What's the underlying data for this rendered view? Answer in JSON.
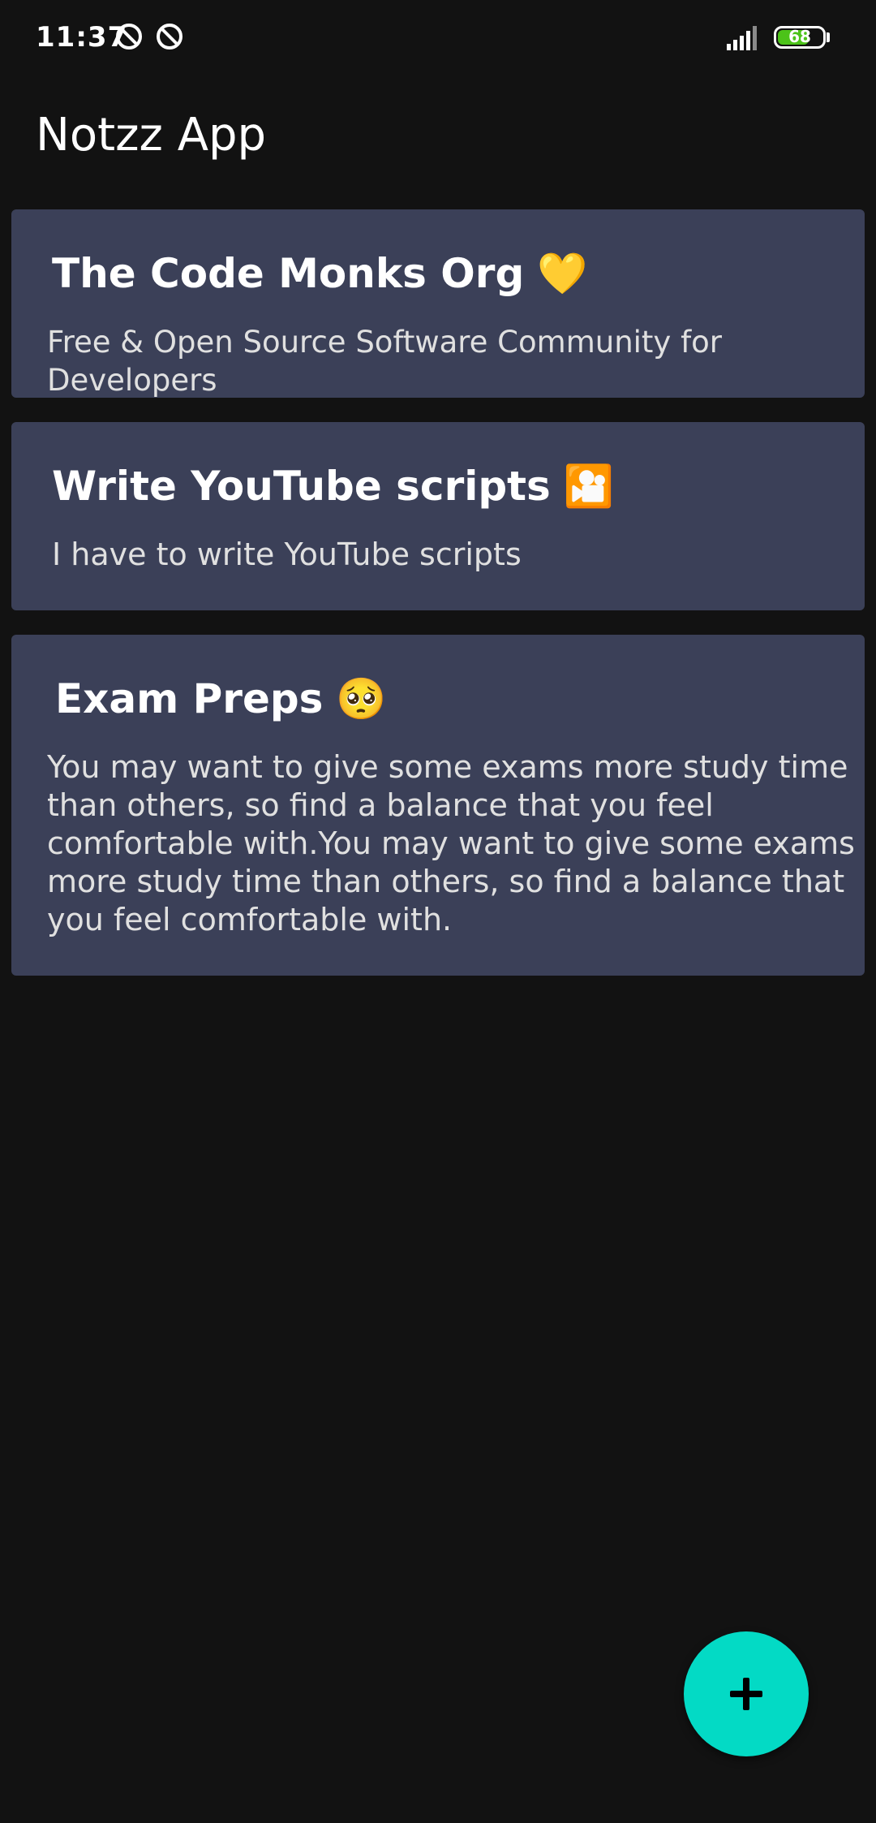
{
  "status_bar": {
    "time": "11:37",
    "battery_level": "68",
    "icons": [
      "do-not-disturb-icon",
      "do-not-disturb-icon",
      "signal-icon",
      "battery-icon"
    ]
  },
  "app": {
    "title": "Notzz App"
  },
  "notes": [
    {
      "title": "The Code Monks Org",
      "emoji": "💛",
      "body": "Free & Open Source Software Community for Developers"
    },
    {
      "title": "Write YouTube scripts",
      "emoji": "🎦",
      "body": "I have to write YouTube scripts"
    },
    {
      "title": "Exam Preps",
      "emoji": "🥺",
      "body": "You may want to give some exams more study time than others, so find a balance that you feel comfortable with.You may want to give some exams more study time than others, so find a balance that you feel comfortable with."
    }
  ],
  "fab": {
    "icon": "plus-icon"
  },
  "colors": {
    "background": "#121212",
    "card": "#3b4058",
    "fab": "#03dac5",
    "battery": "#4cc319"
  }
}
